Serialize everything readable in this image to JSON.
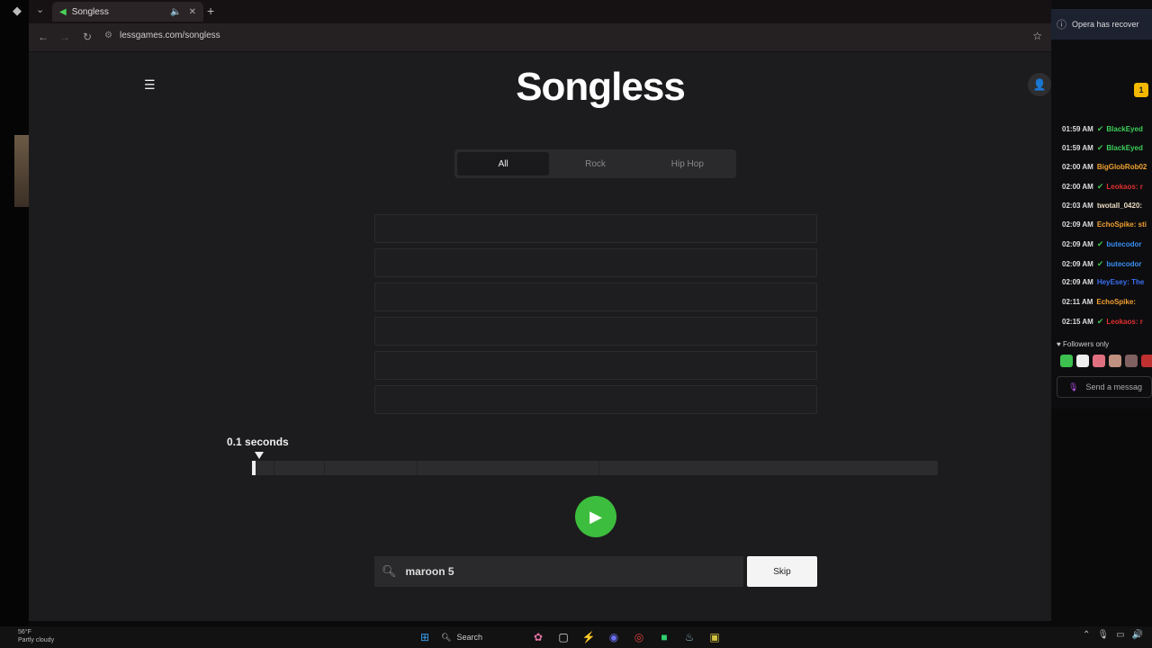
{
  "browser": {
    "tab_title": "Songless",
    "url": "lessgames.com/songless"
  },
  "page": {
    "logo": "Songless",
    "genre_tabs": [
      "All",
      "Rock",
      "Hip Hop"
    ],
    "active_tab": "All",
    "guess_slots": 6,
    "seconds_label": "0.1 seconds",
    "progress_fraction": 0.005,
    "segment_fractions": [
      0.032,
      0.105,
      0.24,
      0.505
    ],
    "search_value": "maroon 5",
    "skip_label": "Skip"
  },
  "chat": {
    "notice": "Opera has recover",
    "badge": "1",
    "messages": [
      {
        "time": "01:59 AM",
        "verified": true,
        "name": "BlackEyed",
        "color": "#3ccf5a"
      },
      {
        "time": "01:59 AM",
        "verified": true,
        "name": "BlackEyed",
        "color": "#3ccf5a"
      },
      {
        "time": "02:00 AM",
        "verified": false,
        "name": "BigGlobRob02",
        "color": "#f0a030"
      },
      {
        "time": "02:00 AM",
        "verified": true,
        "name": "Leokaos: r",
        "color": "#e03030"
      },
      {
        "time": "02:03 AM",
        "verified": false,
        "name": "twotall_0420:",
        "color": "#e8d8c0"
      },
      {
        "time": "02:09 AM",
        "verified": false,
        "name": "EchoSpike: sti",
        "color": "#f0a030"
      },
      {
        "time": "02:09 AM",
        "verified": true,
        "name": "butecodor",
        "color": "#3a8ef0"
      },
      {
        "time": "02:09 AM",
        "verified": true,
        "name": "butecodor",
        "color": "#3a8ef0"
      },
      {
        "time": "02:09 AM",
        "verified": false,
        "name": "HeyEsey: The",
        "color": "#3a6ef0"
      },
      {
        "time": "02:11 AM",
        "verified": false,
        "name": "EchoSpike:",
        "color": "#f0a030"
      },
      {
        "time": "02:15 AM",
        "verified": true,
        "name": "Leokaos: r",
        "color": "#e03030"
      }
    ],
    "followers_only": "Followers only",
    "send_placeholder": "Send a messag"
  },
  "taskbar": {
    "temp": "56°F",
    "weather": "Partly cloudy",
    "search_label": "Search"
  }
}
